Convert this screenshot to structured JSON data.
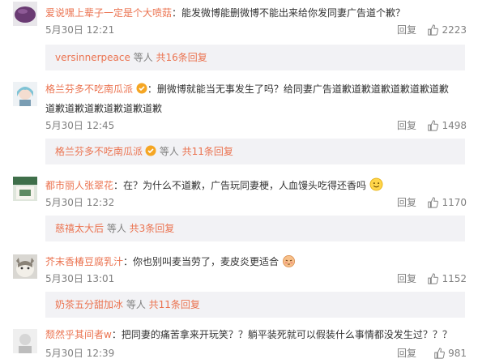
{
  "comments": [
    {
      "username": "爱说嘿上辈子一定是个大喷菇",
      "text": "：能发微博能删微博不能出来给你发同妻广告道个歉？",
      "time": "5月30日 12:21",
      "reply": "回复",
      "likes": "2223",
      "sub": {
        "user": "versinnerpeace",
        "mid": " 等人 ",
        "count": "共16条回复"
      }
    },
    {
      "username": "格兰芬多不吃南瓜派",
      "text_line1": "：删微博就能当无事发生了吗？给同妻广告道歉道歉道歉道歉道歉道歉",
      "text_line2": "道歉道歉道歉道歉道歉道歉",
      "time": "5月30日 12:45",
      "reply": "回复",
      "likes": "1498",
      "sub": {
        "user": "格兰芬多不吃南瓜派",
        "mid": " 等人 ",
        "count": "共11条回复"
      }
    },
    {
      "username": "都市丽人张翠花",
      "text": "：在？为什么不道歉，广告玩同妻梗，人血馒头吃得还香吗",
      "time": "5月30日 12:32",
      "reply": "回复",
      "likes": "1170",
      "sub": {
        "user": "慈禧太大后",
        "mid": " 等人 ",
        "count": "共3条回复"
      }
    },
    {
      "username": "芥末香椿豆腐乳汁",
      "text": "：你也别叫麦当劳了，麦皮炎更适合",
      "time": "5月30日 13:01",
      "reply": "回复",
      "likes": "1152",
      "sub": {
        "user": "奶茶五分甜加冰",
        "mid": " 等人 ",
        "count": "共11条回复"
      }
    },
    {
      "username": "颓然乎其间者w",
      "text": "：把同妻的痛苦拿来开玩笑？？躺平装死就可以假装什么事情都没发生过？？？",
      "time": "5月30日 12:39",
      "reply": "回复",
      "likes": "981"
    }
  ],
  "colors": {
    "username": "#eb7350",
    "meta": "#808080",
    "subbox": "#f2f2f5"
  },
  "icons": [
    "thumbs-up-icon",
    "user-badge-icon",
    "smile-emoji-icon",
    "shy-emoji-icon"
  ]
}
